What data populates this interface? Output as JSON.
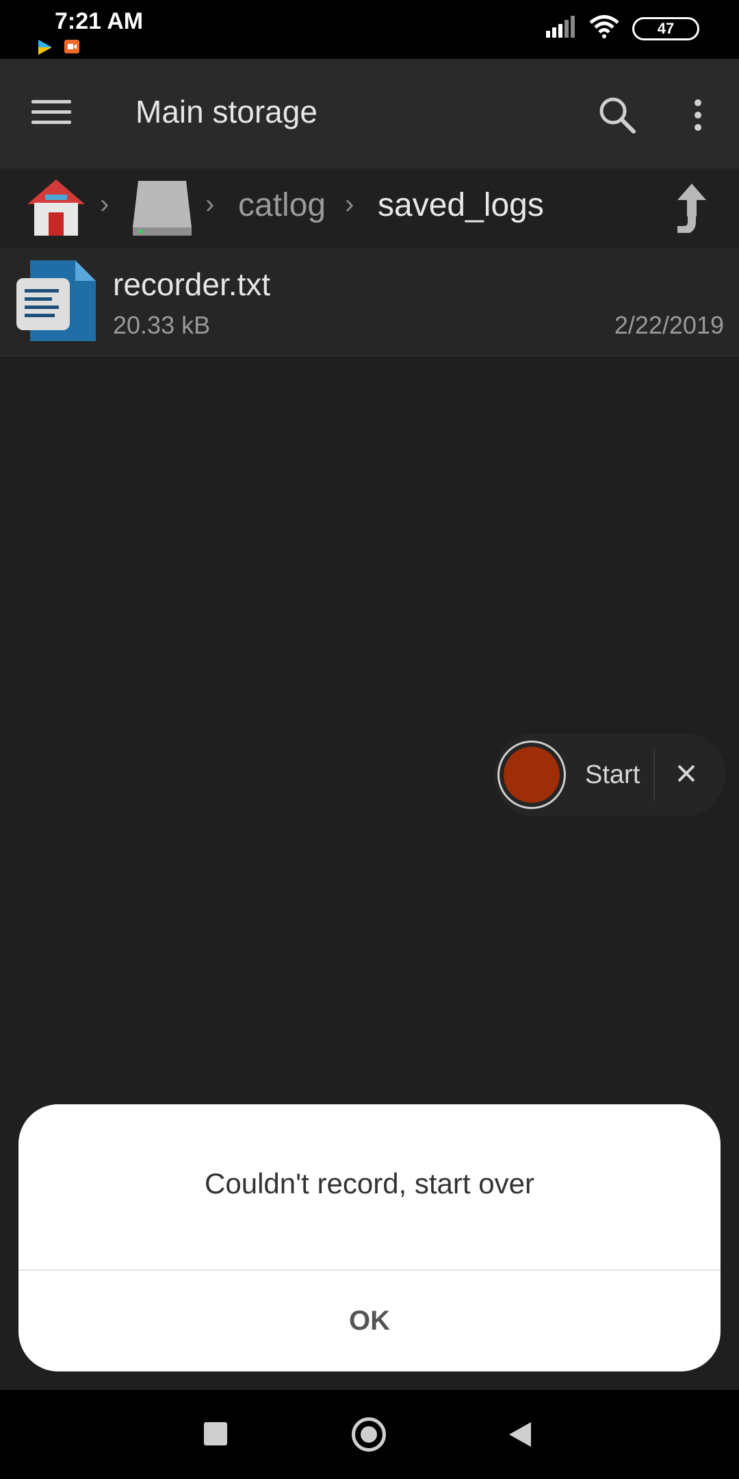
{
  "status_bar": {
    "time": "7:21 AM",
    "battery": "47",
    "icons": [
      "signal-icon",
      "wifi-icon",
      "battery-icon"
    ],
    "notification_icons": [
      "play-store-icon",
      "screen-recorder-icon"
    ]
  },
  "toolbar": {
    "title": "Main storage",
    "icons": [
      "menu-icon",
      "search-icon",
      "more-vert-icon"
    ]
  },
  "breadcrumb": {
    "items": [
      "home-icon",
      "storage-drive-icon",
      "catlog",
      "saved_logs"
    ],
    "folder_1": "catlog",
    "folder_2": "saved_logs",
    "up_icon": "up-arrow-icon"
  },
  "files": [
    {
      "name": "recorder.txt",
      "size": "20.33 kB",
      "date": "2/22/2019",
      "icon": "text-document-icon"
    }
  ],
  "recorder": {
    "start_label": "Start",
    "close_icon": "close-icon",
    "colors": {
      "record": "#9e2e08"
    }
  },
  "dialog": {
    "message": "Couldn't record, start over",
    "ok_label": "OK"
  },
  "nav_bar": {
    "icons": [
      "recents-icon",
      "home-icon",
      "back-icon"
    ]
  }
}
